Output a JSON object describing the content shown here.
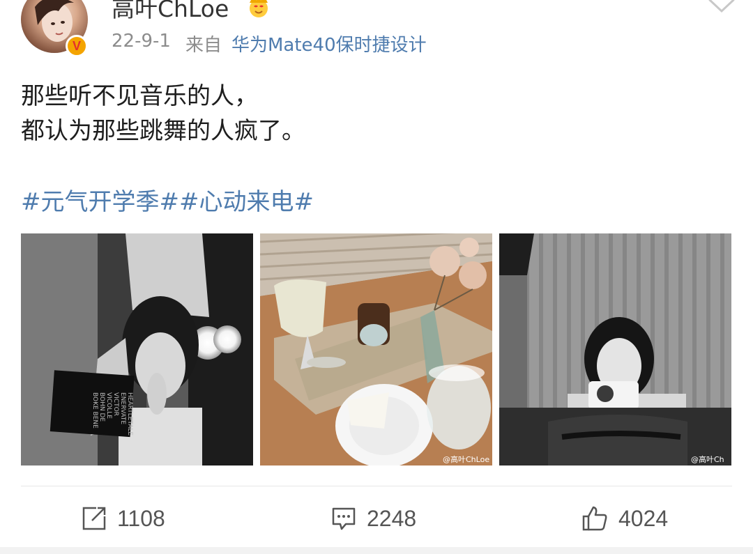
{
  "post": {
    "username": "高叶ChLoe",
    "date": "22-9-1",
    "from_label": "来自",
    "device": "华为Mate40保时捷设计",
    "text_lines": [
      "那些听不见音乐的人，",
      "都认为那些跳舞的人疯了。"
    ],
    "tags": [
      "#元气开学季#",
      "#心动来电#"
    ],
    "verified_badge": "V",
    "badge_color": "#f4a400",
    "link_color": "#4f7cae",
    "images": [
      {
        "subject": "black-and-white photo of woman reading at vanity mirror",
        "book_text": [
          "BOKE BENE",
          "BOHN DE",
          "VICOLLE",
          "VICTOR",
          "ENERVATE",
          "HEARTLETALE"
        ]
      },
      {
        "subject": "cafe table with drinks, cake and flowers",
        "watermark": "@高叶ChLoe"
      },
      {
        "subject": "black-and-white photo of woman holding phone",
        "watermark": "@高叶Ch"
      }
    ]
  },
  "actions": {
    "reposts": "1108",
    "comments": "2248",
    "likes": "4024"
  },
  "icons": {
    "crown": "crown-emoji-icon",
    "chevron": "chevron-down-icon",
    "repost": "repost-icon",
    "comment": "comment-icon",
    "like": "thumbs-up-icon"
  }
}
